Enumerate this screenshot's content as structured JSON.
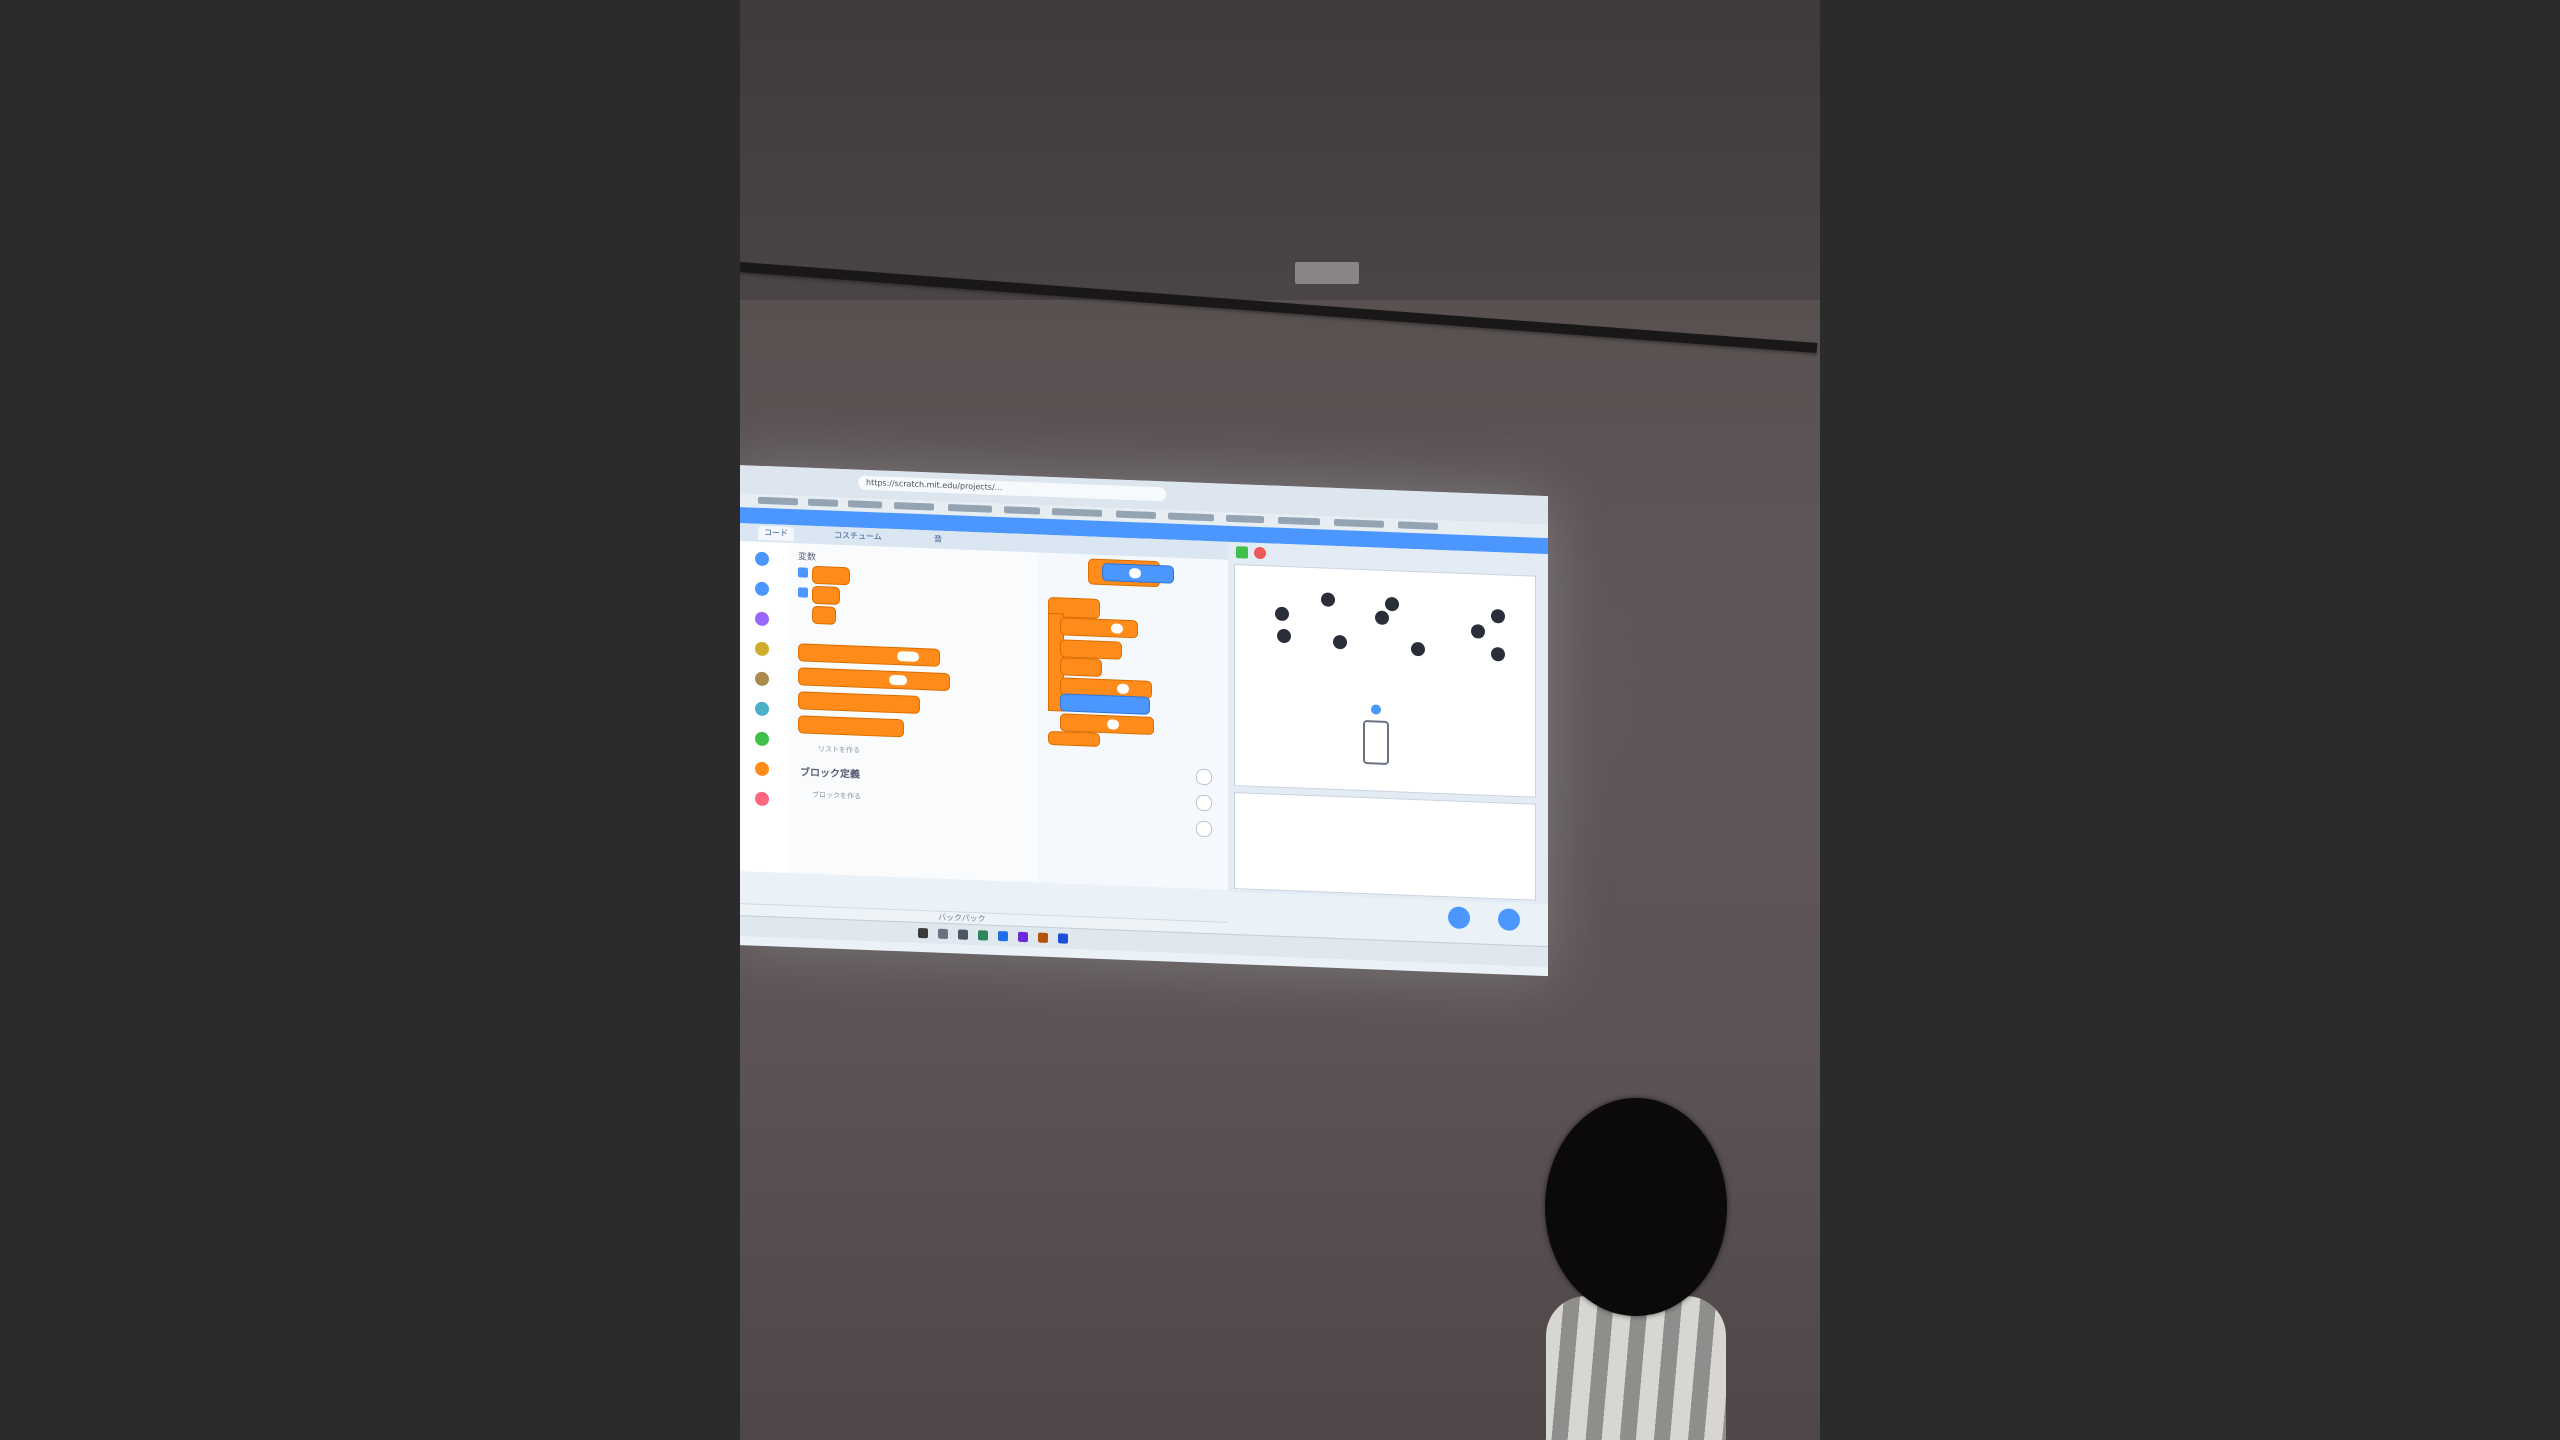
{
  "scene": {
    "description_type": "photo of projected screen",
    "colors": {
      "wall": "#5d5455",
      "letterbox": "#2b2b2d",
      "scratch_blue": "#4c97ff",
      "block_orange": "#ff8c1a"
    }
  },
  "projection": {
    "url": "https://scratch.mit.edu/projects/...",
    "tabs": [
      {
        "label": "コード",
        "active": true
      },
      {
        "label": "コスチューム",
        "active": false
      },
      {
        "label": "音",
        "active": false
      }
    ],
    "palette": {
      "title": "変数",
      "make_block_label": "ブロック定義",
      "make_block_button": "ブロックを作る",
      "make_list_button": "リストを作る"
    },
    "backpack_label": "バックパック",
    "icons": [
      "green-flag-icon",
      "stop-icon",
      "zoom-in-icon",
      "zoom-out-icon",
      "zoom-reset-icon",
      "add-sprite-icon",
      "add-backdrop-icon"
    ]
  }
}
